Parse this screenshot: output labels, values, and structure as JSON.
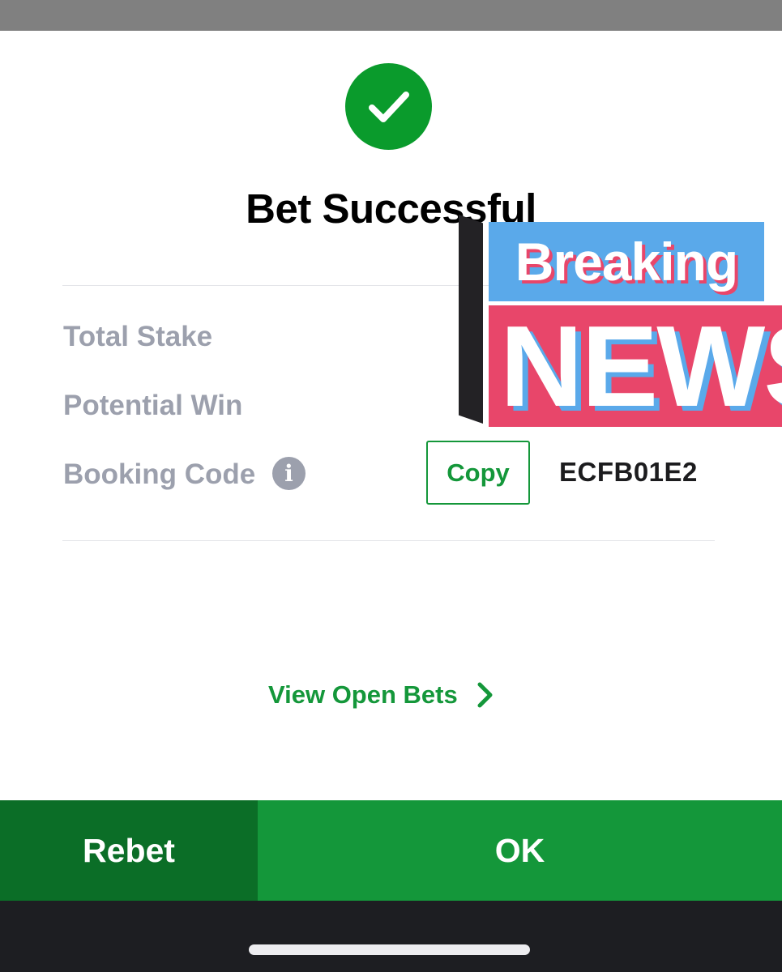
{
  "dialog": {
    "title": "Bet Successful",
    "rows": [
      {
        "label": "Total Stake"
      },
      {
        "label": "Potential Win"
      },
      {
        "label": "Booking Code"
      }
    ],
    "info_icon_glyph": "i",
    "copy_label": "Copy",
    "booking_code": "ECFB01E2",
    "view_open_bets": "View Open Bets"
  },
  "sticker": {
    "line1": "Breaking",
    "line2": "NEWS"
  },
  "actions": {
    "rebet_label": "Rebet",
    "ok_label": "OK"
  },
  "colors": {
    "brand_green": "#14973a",
    "dark_green": "#0b6e27",
    "success_green": "#0a9b2c",
    "label_gray": "#9ca0ad",
    "sticker_blue": "#5aa9ea",
    "sticker_pink": "#e8466a"
  },
  "icons": {
    "success": "check-circle-icon",
    "info": "info-icon",
    "chevron": "chevron-right-icon"
  }
}
